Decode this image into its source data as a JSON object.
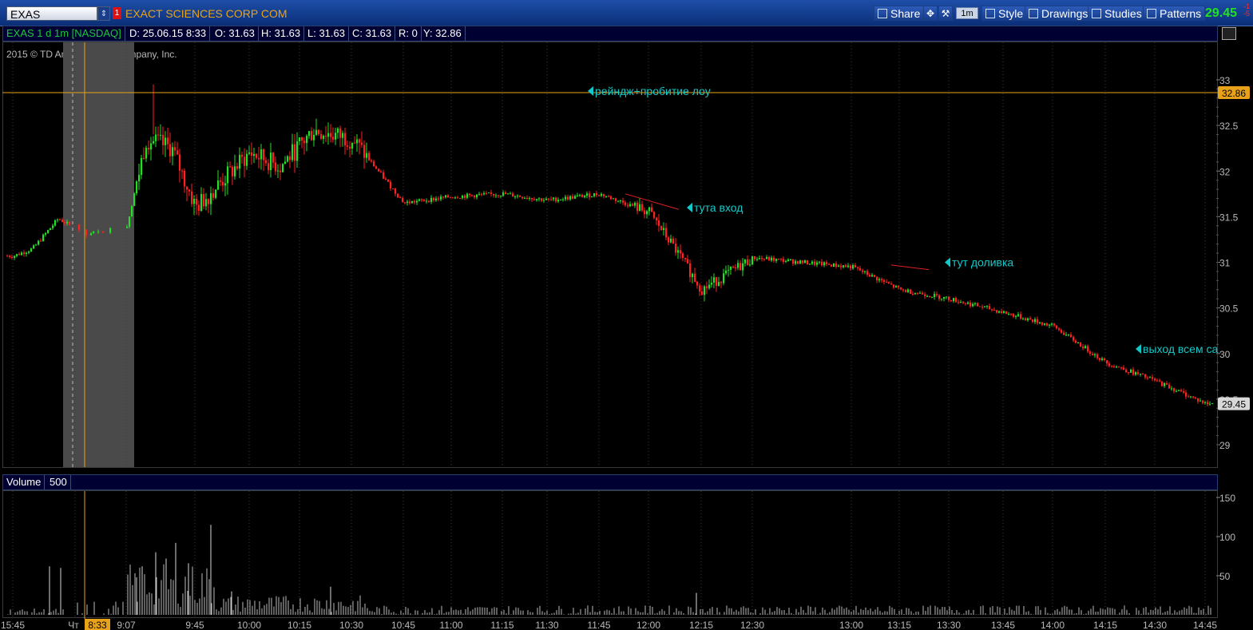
{
  "toolbar": {
    "symbol": "EXAS",
    "flag": "1",
    "company": "EXACT SCIENCES CORP COM",
    "share_label": "Share",
    "timeframe_badge": "1m",
    "style_label": "Style",
    "drawings_label": "Drawings",
    "studies_label": "Studies",
    "patterns_label": "Patterns",
    "last_price": "29.45",
    "last_change_1": "-1",
    "last_change_2": "-5"
  },
  "infobar": {
    "title": "EXAS 1 d 1m [NASDAQ]",
    "date": "D: 25.06.15 8:33",
    "open": "O: 31.63",
    "high": "H: 31.63",
    "low": "L: 31.63",
    "close": "C: 31.63",
    "range": "R: 0",
    "y": "Y: 32.86"
  },
  "copyright": "2015 © TD Ameritrade IP Company, Inc.",
  "volume_header": {
    "label": "Volume",
    "value": "500"
  },
  "colors": {
    "up": "#22e022",
    "down": "#ff2020",
    "cursor": "#e8a21a",
    "annotation": "#12c8c8",
    "drawing_line": "#e02020"
  },
  "chart_data": [
    {
      "type": "candlestick",
      "title": "EXAS 1 d 1m [NASDAQ]",
      "xlabel": "",
      "ylabel": "",
      "x_ticks": [
        "15:45",
        "Чт",
        "9:07",
        "9:45",
        "10:00",
        "10:15",
        "10:30",
        "10:45",
        "11:00",
        "11:15",
        "11:30",
        "11:45",
        "12:00",
        "12:15",
        "12:30",
        "13:00",
        "13:15",
        "13:30",
        "13:45",
        "14:00",
        "14:15",
        "14:30",
        "14:45"
      ],
      "cursor_time": "8:33",
      "y_ticks": [
        "33",
        "32.5",
        "32",
        "31.5",
        "31",
        "30.5",
        "30",
        "29.5",
        "29"
      ],
      "ylim": [
        28.75,
        33.4
      ],
      "cursor_price": "32.86",
      "last_price": "29.45",
      "grid": "dotted vertical only",
      "close_path": [
        {
          "t": "15:45",
          "p": 31.07
        },
        {
          "t": "16:00",
          "p": 31.15
        },
        {
          "t": "8:00",
          "p": 31.48
        },
        {
          "t": "8:33",
          "p": 31.3
        },
        {
          "t": "9:07",
          "p": 31.4
        },
        {
          "t": "9:15",
          "p": 32.35
        },
        {
          "t": "9:30",
          "p": 32.25
        },
        {
          "t": "9:45",
          "p": 31.6
        },
        {
          "t": "10:00",
          "p": 32.2
        },
        {
          "t": "10:10",
          "p": 32.05
        },
        {
          "t": "10:20",
          "p": 32.45
        },
        {
          "t": "10:30",
          "p": 32.35
        },
        {
          "t": "10:45",
          "p": 31.65
        },
        {
          "t": "11:00",
          "p": 31.72
        },
        {
          "t": "11:15",
          "p": 31.75
        },
        {
          "t": "11:30",
          "p": 31.68
        },
        {
          "t": "11:45",
          "p": 31.75
        },
        {
          "t": "12:00",
          "p": 31.55
        },
        {
          "t": "12:08",
          "p": 31.2
        },
        {
          "t": "12:15",
          "p": 30.7
        },
        {
          "t": "12:30",
          "p": 31.05
        },
        {
          "t": "13:00",
          "p": 30.95
        },
        {
          "t": "13:15",
          "p": 30.7
        },
        {
          "t": "13:30",
          "p": 30.6
        },
        {
          "t": "13:45",
          "p": 30.45
        },
        {
          "t": "14:00",
          "p": 30.3
        },
        {
          "t": "14:15",
          "p": 29.9
        },
        {
          "t": "14:30",
          "p": 29.7
        },
        {
          "t": "14:45",
          "p": 29.45
        }
      ],
      "annotations": [
        {
          "text": "рейндж+пробитие лоу",
          "t": "11:45",
          "p": 32.86
        },
        {
          "text": "тута вход",
          "t": "12:15",
          "p": 31.6
        },
        {
          "text": "тут доливка",
          "t": "13:30",
          "p": 31.0
        },
        {
          "text": "выход всем са",
          "t": "14:15",
          "p": 30.05
        }
      ]
    },
    {
      "type": "bar",
      "title": "Volume",
      "y_ticks": [
        "150",
        "100",
        "50"
      ],
      "ylim": [
        0,
        150
      ],
      "notable_bars": [
        {
          "t": "8:15",
          "v": 62
        },
        {
          "t": "9:30",
          "v": 92
        },
        {
          "t": "9:45",
          "v": 115
        },
        {
          "t": "10:30",
          "v": 36
        },
        {
          "t": "12:15",
          "v": 28
        }
      ]
    }
  ]
}
